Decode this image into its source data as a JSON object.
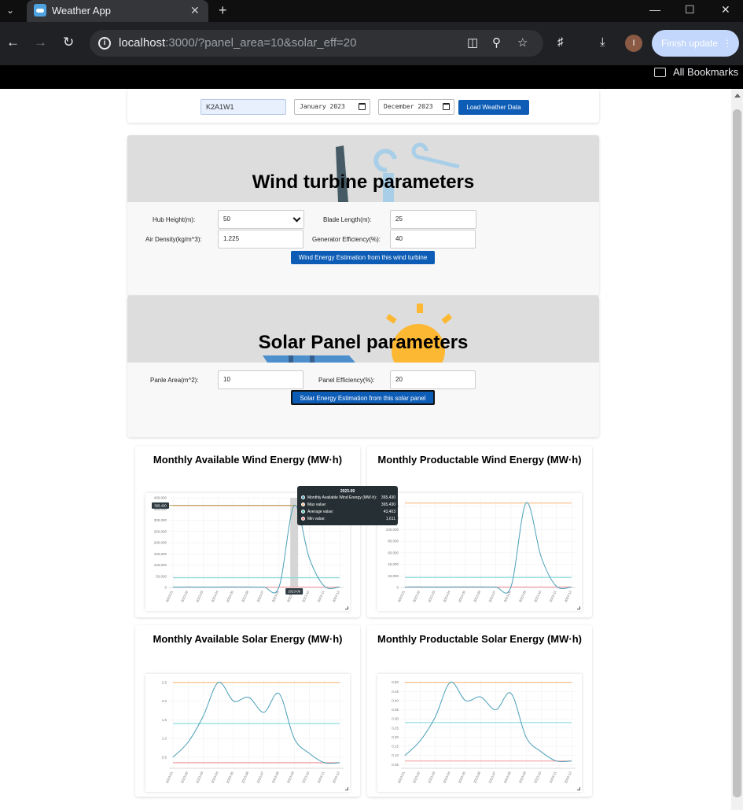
{
  "browser": {
    "tab_title": "Weather App",
    "url_host": "localhost",
    "url_rest": ":3000/?panel_area=10&solar_eff=20",
    "finish_update": "Finish update",
    "bookmarks_label": "All Bookmarks",
    "avatar_letter": "I"
  },
  "query": {
    "location": "K2A1W1",
    "start_date": "January 2023",
    "end_date": "December 2023",
    "load_button": "Load Weather Data"
  },
  "wind": {
    "title": "Wind turbine parameters",
    "hub_height_label": "Hub Height(m):",
    "hub_height_value": "50",
    "blade_length_label": "Blade Length(m):",
    "blade_length_value": "25",
    "air_density_label": "Air Density(kg/m^3):",
    "air_density_value": "1.225",
    "generator_eff_label": "Generator Efficiency(%):",
    "generator_eff_value": "40",
    "estimate_button": "Wind Energy Estimation from this wind turbine"
  },
  "solar": {
    "title": "Solar Panel parameters",
    "panel_area_label": "Panle Area(m^2):",
    "panel_area_value": "10",
    "panel_eff_label": "Panel Efficiency(%):",
    "panel_eff_value": "20",
    "estimate_button": "Solar Energy Estimation from this solar panel"
  },
  "colors": {
    "accent": "#0d5cb6",
    "series_line": "#4a9fb8",
    "max_line": "#f8c08a",
    "avg_line": "#8fdcdc",
    "min_line": "#f2a0a6"
  },
  "tooltip": {
    "title": "2023-09",
    "rows": [
      {
        "name": "Monthly Available Wind Energy (MW·h):",
        "value": "365,430",
        "color": "#4a9fb8"
      },
      {
        "name": "Max value:",
        "value": "365,430",
        "color": "#f8c08a"
      },
      {
        "name": "Average value:",
        "value": "43,403",
        "color": "#4fc3b0"
      },
      {
        "name": "Min value:",
        "value": "1,611",
        "color": "#f28a92"
      }
    ],
    "axis_marker_x": "2023-09",
    "axis_marker_y": "365,430"
  },
  "chart_data": [
    {
      "type": "line",
      "title": "Monthly Available Wind Energy (MW·h)",
      "x": [
        "2023-01",
        "2023-02",
        "2023-03",
        "2023-04",
        "2023-05",
        "2023-06",
        "2023-07",
        "2023-08",
        "2023-09",
        "2023-10",
        "2023-11",
        "2023-12"
      ],
      "series": [
        {
          "values": [
            1800,
            2000,
            1611,
            1900,
            2200,
            2100,
            1700,
            2500,
            365430,
            130000,
            5000,
            2000
          ]
        },
        {
          "name": "Max value",
          "values": [
            365430,
            365430,
            365430,
            365430,
            365430,
            365430,
            365430,
            365430,
            365430,
            365430,
            365430,
            365430
          ]
        },
        {
          "name": "Average value",
          "values": [
            43403,
            43403,
            43403,
            43403,
            43403,
            43403,
            43403,
            43403,
            43403,
            43403,
            43403,
            43403
          ]
        },
        {
          "name": "Min value",
          "values": [
            1611,
            1611,
            1611,
            1611,
            1611,
            1611,
            1611,
            1611,
            1611,
            1611,
            1611,
            1611
          ]
        }
      ],
      "yticks": [
        "0",
        "50,000",
        "100,000",
        "150,000",
        "200,000",
        "250,000",
        "300,000",
        "350,000",
        "400,000"
      ],
      "ylim": [
        0,
        400000
      ],
      "highlight_index": 8,
      "grid": true
    },
    {
      "type": "line",
      "title": "Monthly Productable Wind Energy (MW·h)",
      "x": [
        "2023-01",
        "2023-02",
        "2023-03",
        "2023-04",
        "2023-05",
        "2023-06",
        "2023-07",
        "2023-08",
        "2023-09",
        "2023-10",
        "2023-11",
        "2023-12"
      ],
      "series": [
        {
          "values": [
            700,
            800,
            640,
            760,
            880,
            840,
            680,
            1000,
            146000,
            52000,
            2000,
            800
          ]
        },
        {
          "name": "Max value",
          "values": [
            146000,
            146000,
            146000,
            146000,
            146000,
            146000,
            146000,
            146000,
            146000,
            146000,
            146000,
            146000
          ]
        },
        {
          "name": "Average value",
          "values": [
            17300,
            17300,
            17300,
            17300,
            17300,
            17300,
            17300,
            17300,
            17300,
            17300,
            17300,
            17300
          ]
        },
        {
          "name": "Min value",
          "values": [
            640,
            640,
            640,
            640,
            640,
            640,
            640,
            640,
            640,
            640,
            640,
            640
          ]
        }
      ],
      "yticks": [
        "0",
        "20,000",
        "40,000",
        "60,000",
        "80,000",
        "100,000",
        "120,000",
        "140,000"
      ],
      "ylim": [
        0,
        155000
      ],
      "grid": true
    },
    {
      "type": "line",
      "title": "Monthly Available Solar Energy (MW·h)",
      "x": [
        "2023-01",
        "2023-02",
        "2023-03",
        "2023-04",
        "2023-05",
        "2023-06",
        "2023-07",
        "2023-08",
        "2023-09",
        "2023-10",
        "2023-11",
        "2023-12"
      ],
      "series": [
        {
          "values": [
            0.5,
            0.9,
            1.6,
            2.5,
            2.0,
            2.1,
            1.7,
            2.2,
            1.0,
            0.6,
            0.35,
            0.35
          ]
        },
        {
          "name": "Max value",
          "values": [
            2.5,
            2.5,
            2.5,
            2.5,
            2.5,
            2.5,
            2.5,
            2.5,
            2.5,
            2.5,
            2.5,
            2.5
          ]
        },
        {
          "name": "Average value",
          "values": [
            1.4,
            1.4,
            1.4,
            1.4,
            1.4,
            1.4,
            1.4,
            1.4,
            1.4,
            1.4,
            1.4,
            1.4
          ]
        },
        {
          "name": "Min value",
          "values": [
            0.35,
            0.35,
            0.35,
            0.35,
            0.35,
            0.35,
            0.35,
            0.35,
            0.35,
            0.35,
            0.35,
            0.35
          ]
        }
      ],
      "yticks": [
        "0.5",
        "1.0",
        "1.5",
        "2.0",
        "2.5"
      ],
      "ylim": [
        0.2,
        2.6
      ],
      "grid": true
    },
    {
      "type": "line",
      "title": "Monthly Productable Solar Energy (MW·h)",
      "x": [
        "2023-01",
        "2023-02",
        "2023-03",
        "2023-04",
        "2023-05",
        "2023-06",
        "2023-07",
        "2023-08",
        "2023-09",
        "2023-10",
        "2023-11",
        "2023-12"
      ],
      "series": [
        {
          "values": [
            0.1,
            0.18,
            0.31,
            0.5,
            0.4,
            0.42,
            0.35,
            0.44,
            0.2,
            0.12,
            0.07,
            0.07
          ]
        },
        {
          "name": "Max value",
          "values": [
            0.5,
            0.5,
            0.5,
            0.5,
            0.5,
            0.5,
            0.5,
            0.5,
            0.5,
            0.5,
            0.5,
            0.5
          ]
        },
        {
          "name": "Average value",
          "values": [
            0.28,
            0.28,
            0.28,
            0.28,
            0.28,
            0.28,
            0.28,
            0.28,
            0.28,
            0.28,
            0.28,
            0.28
          ]
        },
        {
          "name": "Min value",
          "values": [
            0.07,
            0.07,
            0.07,
            0.07,
            0.07,
            0.07,
            0.07,
            0.07,
            0.07,
            0.07,
            0.07,
            0.07
          ]
        }
      ],
      "yticks": [
        "0.05",
        "0.10",
        "0.15",
        "0.20",
        "0.25",
        "0.30",
        "0.35",
        "0.40",
        "0.45",
        "0.50"
      ],
      "ylim": [
        0.03,
        0.52
      ],
      "grid": true
    }
  ]
}
